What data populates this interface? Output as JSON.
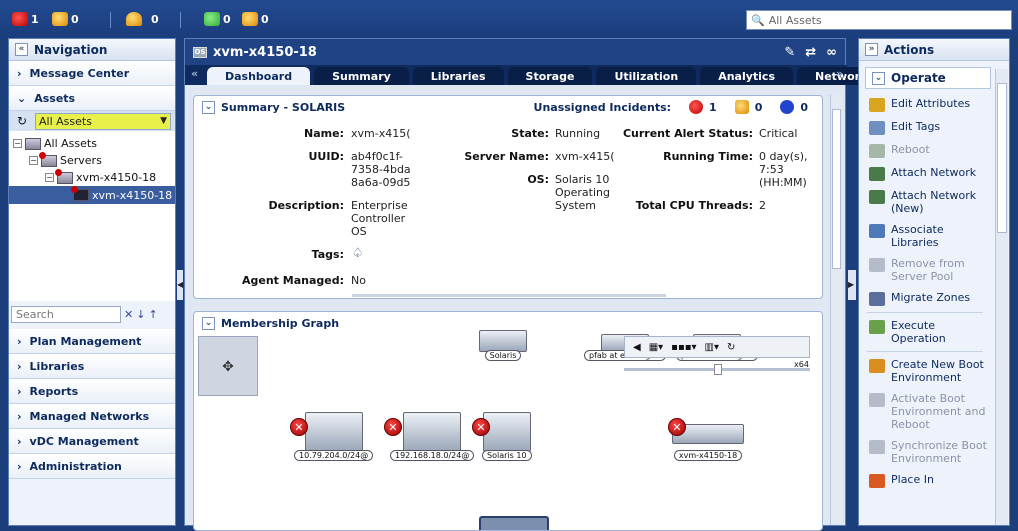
{
  "topbar": {
    "critical_count": "1",
    "warning_count": "0",
    "unassigned_count": "0",
    "users_critical_count": "0",
    "users_warning_count": "0",
    "search_placeholder": "All Assets"
  },
  "navigation": {
    "title": "Navigation",
    "message_center": "Message Center",
    "assets": "Assets",
    "asset_filter": "All Assets",
    "tree": [
      {
        "label": "All Assets",
        "level": 0
      },
      {
        "label": "Servers",
        "level": 1
      },
      {
        "label": "xvm-x4150-18",
        "level": 2
      },
      {
        "label": "xvm-x4150-18",
        "level": 3,
        "selected": true
      }
    ],
    "search_placeholder": "Search",
    "sections": [
      "Plan Management",
      "Libraries",
      "Reports",
      "Managed Networks",
      "vDC Management",
      "Administration"
    ]
  },
  "main": {
    "title": "xvm-x4150-18",
    "title_icon_label": "OS",
    "tabs": [
      "Dashboard",
      "Summary",
      "Libraries",
      "Storage",
      "Utilization",
      "Analytics",
      "Networks"
    ],
    "active_tab": "Dashboard",
    "summary": {
      "header": "Summary - SOLARIS",
      "unassigned_label": "Unassigned Incidents:",
      "inc_critical": "1",
      "inc_warning": "0",
      "inc_info": "0",
      "name_label": "Name:",
      "name_value": "xvm-x415(",
      "uuid_label": "UUID:",
      "uuid_value": "ab4f0c1f-\n7358-4bda\n8a6a-09d5",
      "description_label": "Description:",
      "description_value": "Enterprise\nController\nOS",
      "tags_label": "Tags:",
      "agent_label": "Agent Managed:",
      "agent_value": "No",
      "state_label": "State:",
      "state_value": "Running",
      "server_name_label": "Server Name:",
      "server_name_value": "xvm-x415(",
      "os_label": "OS:",
      "os_value": "Solaris 10\nOperating\nSystem",
      "alert_label": "Current Alert Status:",
      "alert_value": "Critical",
      "running_label": "Running Time:",
      "running_value": "0 day(s),\n7:53\n(HH:MM)",
      "cpu_label": "Total CPU Threads:",
      "cpu_value": "2"
    },
    "graph": {
      "header": "Membership Graph",
      "top_nodes": [
        "Solaris",
        "pfab at e1000g0 :",
        "pfab at e1000g1 :",
        "x64"
      ],
      "nodes": [
        "10.79.204.0/24@",
        "192.168.18.0/24@",
        "Solaris 10",
        "xvm-x4150-18"
      ]
    }
  },
  "actions": {
    "title": "Actions",
    "operate": "Operate",
    "items": [
      {
        "label": "Edit Attributes",
        "enabled": true,
        "color": "#d9a520"
      },
      {
        "label": "Edit Tags",
        "enabled": true,
        "color": "#6f8fc0"
      },
      {
        "label": "Reboot",
        "enabled": false,
        "color": "#a7b7a7"
      },
      {
        "label": "Attach Network",
        "enabled": true,
        "color": "#4a7a4a"
      },
      {
        "label": "Attach Network (New)",
        "enabled": true,
        "color": "#4a7a4a"
      },
      {
        "label": "Associate Libraries",
        "enabled": true,
        "color": "#4d79b8"
      },
      {
        "label": "Remove from Server Pool",
        "enabled": false,
        "color": "#b4bcc9"
      },
      {
        "label": "Migrate Zones",
        "enabled": true,
        "color": "#5a6f9a"
      },
      {
        "label": "Execute Operation",
        "enabled": true,
        "color": "#6aa04a"
      },
      {
        "label": "Create New Boot Environment",
        "enabled": true,
        "color": "#d98e20"
      },
      {
        "label": "Activate Boot Environment and Reboot",
        "enabled": false,
        "color": "#b4bcc9"
      },
      {
        "label": "Synchronize Boot Environment",
        "enabled": false,
        "color": "#b4bcc9"
      },
      {
        "label": "Place In",
        "enabled": true,
        "color": "#d85a20"
      }
    ]
  }
}
